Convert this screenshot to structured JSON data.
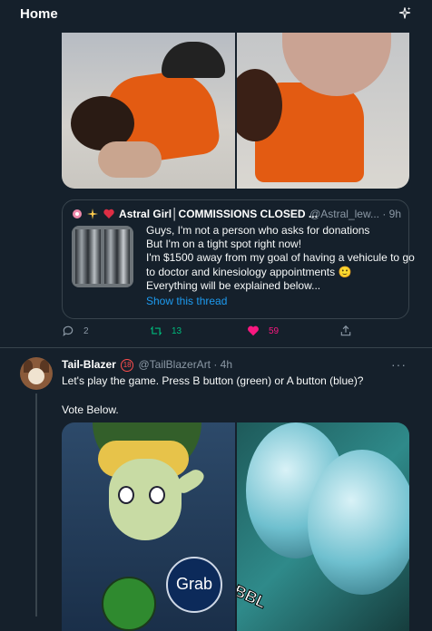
{
  "header": {
    "title": "Home",
    "sparkle_icon": "sparkle-icon"
  },
  "quote_tweet": {
    "name": "Astral Girl│COMMISSIONS CLOSED ...",
    "handle": "@Astral_lew... · 9h",
    "lines": [
      "Guys, I'm not a person who asks for donations",
      "But I'm on a tight spot right now!",
      "I'm $1500 away from my goal of having a vehicule to go",
      "to doctor and kinesiology appointments 🙂",
      "Everything will be explained below..."
    ],
    "show_thread": "Show this thread"
  },
  "actions": {
    "replies": "2",
    "retweets": "13",
    "likes": "59"
  },
  "colors": {
    "background": "#15202b",
    "link": "#1d9bf0",
    "retweet": "#00ba7c",
    "like": "#f91880",
    "muted": "#8b98a5",
    "border": "#38444d"
  },
  "tweet2": {
    "name": "Tail-Blazer",
    "badge": "18",
    "handle": "@TailBlazerArt · 4h",
    "more": "···",
    "line1": "Let's play the game. Press B button (green) or A button (blue)?",
    "line2": "Vote Below.",
    "grab": "Grab",
    "bbl": "BBL"
  }
}
